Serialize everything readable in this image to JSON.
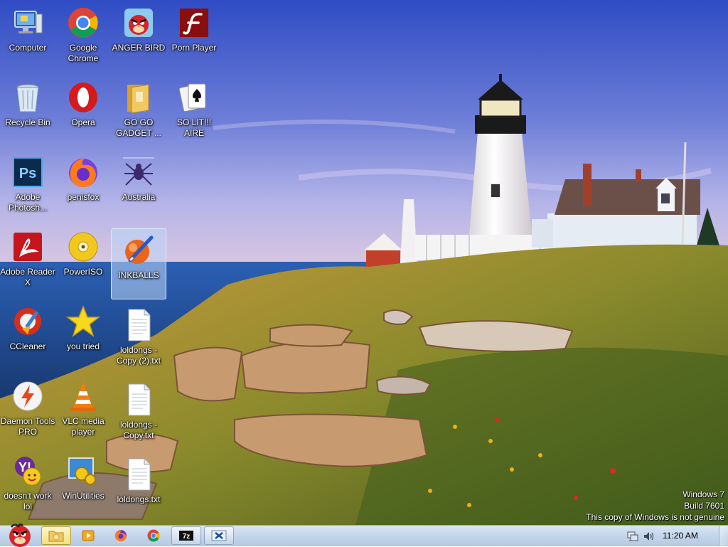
{
  "desktop": {
    "icons": [
      {
        "label": "Computer"
      },
      {
        "label": "Google Chrome"
      },
      {
        "label": "ANGER BIRD"
      },
      {
        "label": "Porn Player"
      },
      {
        "label": "Recycle Bin"
      },
      {
        "label": "Opera"
      },
      {
        "label": "GO GO GADGET ..."
      },
      {
        "label": "SO LIT!!! AIRE"
      },
      {
        "label": "Adobe Photosh..."
      },
      {
        "label": "penisfox"
      },
      {
        "label": "Australia"
      },
      {
        "label": "Adobe Reader X"
      },
      {
        "label": "PowerISO"
      },
      {
        "label": "INKBALLS"
      },
      {
        "label": "CCleaner"
      },
      {
        "label": "you tried"
      },
      {
        "label": "loldongs - Copy (2).txt"
      },
      {
        "label": "Daemon Tools PRO"
      },
      {
        "label": "VLC media player"
      },
      {
        "label": "loldongs - Copy.txt"
      },
      {
        "label": "doesn't work lol"
      },
      {
        "label": "WinUtilities"
      },
      {
        "label": "loldongs.txt"
      }
    ],
    "selected_icon": "INKBALLS"
  },
  "watermark": {
    "line1": "Windows 7",
    "line2": "Build 7601",
    "line3": "This copy of Windows is not genuine"
  },
  "taskbar": {
    "pinned": [
      "explorer-icon",
      "media-player-icon",
      "firefox-icon",
      "chrome-icon",
      "7zip-icon",
      "xmind-icon"
    ],
    "tray": {
      "clock": "11:20 AM",
      "icons": [
        "network-icon",
        "volume-icon"
      ]
    }
  },
  "colors": {
    "taskbar": "#c3d5ea",
    "selection": "#bed7f5",
    "sky_top": "#3b58c8",
    "sea": "#1f4fa0"
  }
}
